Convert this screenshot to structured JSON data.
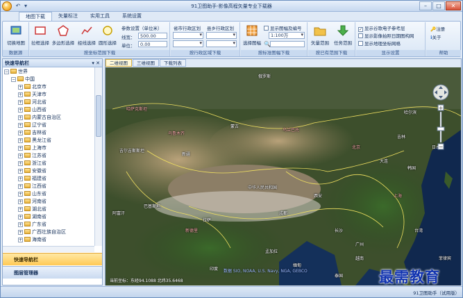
{
  "app": {
    "title": "91卫图助手-影像高程矢量专业下载器"
  },
  "quick_access": [
    "↶",
    "▾"
  ],
  "window_buttons": {
    "minimize": "–",
    "maximize": "□",
    "close": "✕"
  },
  "tabs": [
    {
      "label": "地图下载"
    },
    {
      "label": "矢量标注"
    },
    {
      "label": "实用工具"
    },
    {
      "label": "系统设置"
    }
  ],
  "ribbon": {
    "g1": {
      "btn": "切换地图",
      "label": "数据源"
    },
    "g2": {
      "b1": "拉框选择",
      "b2": "多边形选择",
      "b3": "经线选择",
      "b4": "圆形选择",
      "label": "按坐标范围下载"
    },
    "g2b": {
      "title": "参数设置（单位米）",
      "radius_label": "线宽：",
      "radius_value": "500.00",
      "unit_label": "单位：",
      "unit_value": "0.00"
    },
    "g3": {
      "col1": "省市行政区划",
      "col2": "县乡行政区划",
      "label": "按行政区域下载"
    },
    "g4": {
      "btn": "选择图幅",
      "chk": "显示图幅及编号",
      "scale": "1:100万",
      "label": "按标准图幅下载"
    },
    "g5": {
      "b1": "矢量范围",
      "b2": "任务范围",
      "label": "按已有范围下载"
    },
    "g6": {
      "c1": "显示谷歌电子参考层",
      "c2": "显示影像拍照日期图构网",
      "c3": "显示地理坐标网格",
      "label": "显示设置"
    },
    "g7": {
      "b1": "注册",
      "b2": "关于",
      "label": "帮助"
    }
  },
  "sidebar": {
    "title": "快速导航栏",
    "pin": "▾ ✕",
    "root": "世界",
    "country": "中国",
    "provinces": [
      "北京市",
      "天津市",
      "河北省",
      "山西省",
      "内蒙古自治区",
      "辽宁省",
      "吉林省",
      "黑龙江省",
      "上海市",
      "江苏省",
      "浙江省",
      "安徽省",
      "福建省",
      "江西省",
      "山东省",
      "河南省",
      "湖北省",
      "湖南省",
      "广东省",
      "广西壮族自治区",
      "海南省"
    ],
    "nav_active": "快速导航栏",
    "nav_inactive": "图层管理器"
  },
  "map_tabs": [
    {
      "label": "二维视图"
    },
    {
      "label": "三维视图"
    },
    {
      "label": "下载列表"
    }
  ],
  "map_labels": [
    {
      "text": "俄罗斯",
      "cls": ""
    },
    {
      "text": "哈萨克斯坦",
      "cls": "red"
    },
    {
      "text": "蒙古",
      "cls": ""
    },
    {
      "text": "乌兰巴托",
      "cls": "red"
    },
    {
      "text": "中华人民共和国",
      "cls": ""
    },
    {
      "text": "北京",
      "cls": "red"
    },
    {
      "text": "哈尔滨",
      "cls": ""
    },
    {
      "text": "日本",
      "cls": ""
    },
    {
      "text": "韩国",
      "cls": ""
    },
    {
      "text": "上海",
      "cls": "red"
    },
    {
      "text": "印度",
      "cls": ""
    },
    {
      "text": "巴基斯坦",
      "cls": ""
    },
    {
      "text": "新德里",
      "cls": "red"
    },
    {
      "text": "台湾",
      "cls": ""
    },
    {
      "text": "菲律宾",
      "cls": ""
    },
    {
      "text": "越南",
      "cls": ""
    },
    {
      "text": "泰国",
      "cls": ""
    },
    {
      "text": "孟加拉",
      "cls": ""
    },
    {
      "text": "缅甸",
      "cls": ""
    },
    {
      "text": "拉萨",
      "cls": ""
    },
    {
      "text": "乌鲁木齐",
      "cls": "red"
    },
    {
      "text": "成都",
      "cls": ""
    },
    {
      "text": "阿富汗",
      "cls": ""
    },
    {
      "text": "吉尔吉斯斯坦",
      "cls": ""
    },
    {
      "text": "新疆",
      "cls": ""
    },
    {
      "text": "吉林",
      "cls": ""
    },
    {
      "text": "大连",
      "cls": ""
    },
    {
      "text": "西安",
      "cls": ""
    },
    {
      "text": "长沙",
      "cls": ""
    },
    {
      "text": "广州",
      "cls": ""
    }
  ],
  "map_copyright": "数据 SIO, NOAA, U.S. Navy, NGA, GEBCO",
  "map_coords": "当前坐标：东经94.1088 北纬35.6468",
  "status": {
    "right": "91卫图助手（试用版）"
  },
  "watermark": "最需教育",
  "colors": {
    "accent": "#ffc955",
    "frame": "#9cb6da",
    "ribbon_bg": "#dfe9f6"
  }
}
